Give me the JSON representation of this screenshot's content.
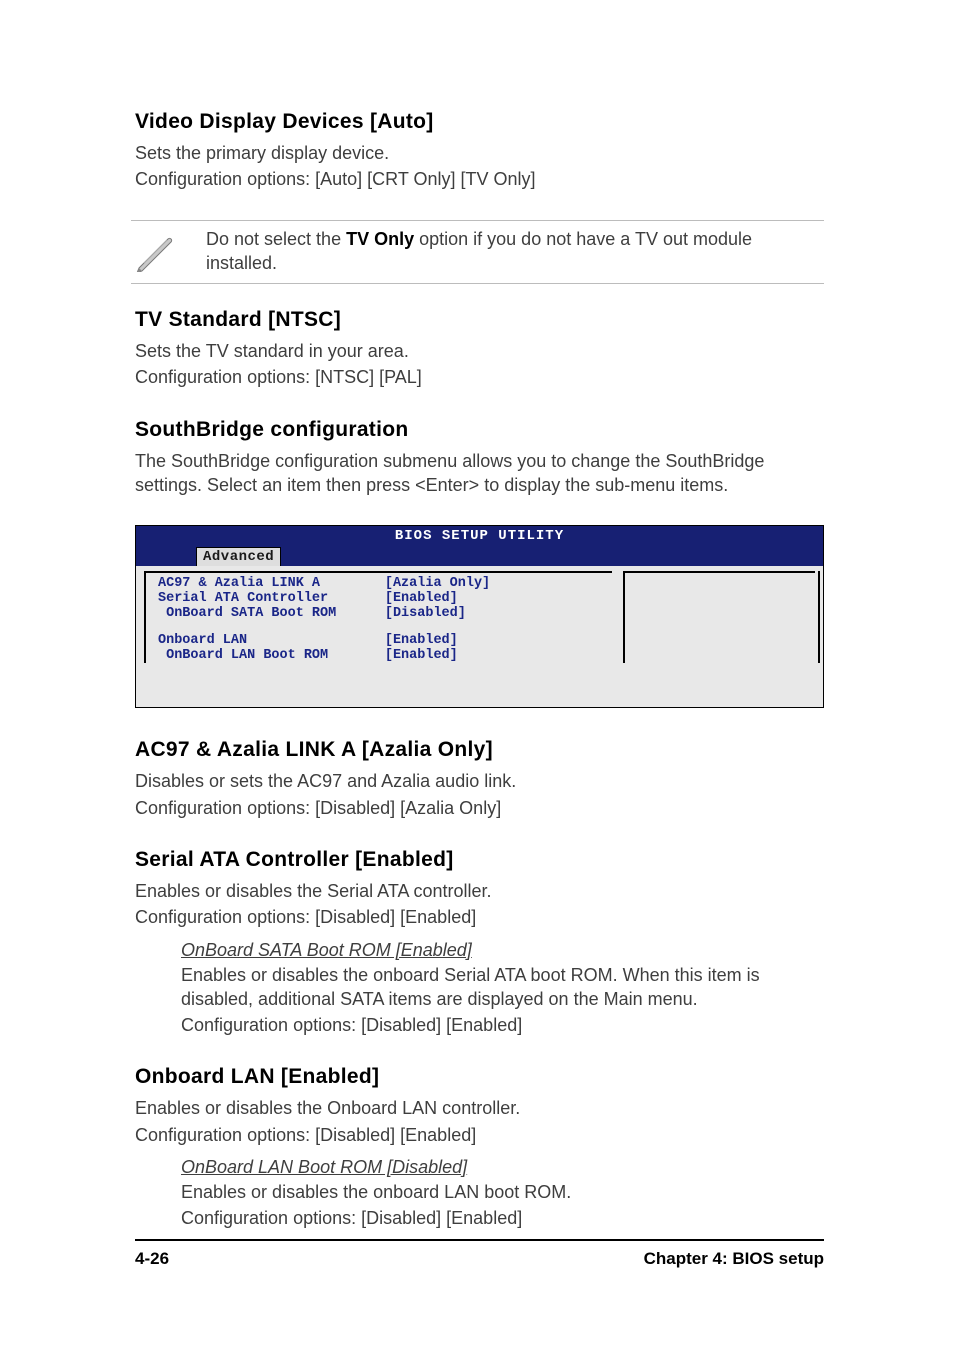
{
  "sections": {
    "video": {
      "heading": "Video Display Devices [Auto]",
      "line1": "Sets the primary display device.",
      "line2": "Configuration options: [Auto] [CRT Only] [TV Only]"
    },
    "note": {
      "pre": "Do not select the ",
      "bold": "TV Only",
      "post": " option if you do not have a TV out module installed."
    },
    "tv": {
      "heading": "TV Standard [NTSC]",
      "line1": "Sets the TV standard  in your area.",
      "line2": "Configuration options: [NTSC] [PAL]"
    },
    "southbridge": {
      "heading": "SouthBridge configuration",
      "line1": "The SouthBridge configuration submenu allows you to change the SouthBridge settings. Select an item then press <Enter> to display the sub-menu items."
    },
    "ac97": {
      "heading": "AC97 & Azalia LINK A [Azalia Only]",
      "line1": "Disables or sets the AC97 and Azalia audio link.",
      "line2": "Configuration options: [Disabled] [Azalia Only]"
    },
    "sata": {
      "heading": "Serial ATA Controller [Enabled]",
      "line1": "Enables or disables the Serial ATA controller.",
      "line2": "Configuration options: [Disabled] [Enabled]",
      "sub": {
        "heading": "OnBoard SATA Boot ROM [Enabled]",
        "line1": "Enables or disables the onboard Serial ATA boot ROM. When this item is disabled, additional SATA items are displayed on the Main menu.",
        "line2": "Configuration options: [Disabled] [Enabled]"
      }
    },
    "lan": {
      "heading": "Onboard LAN [Enabled]",
      "line1": "Enables or disables the Onboard LAN controller.",
      "line2": "Configuration options: [Disabled] [Enabled]",
      "sub": {
        "heading": "OnBoard LAN Boot ROM [Disabled]",
        "line1": "Enables or disables the onboard LAN boot ROM.",
        "line2": "Configuration options: [Disabled] [Enabled]"
      }
    }
  },
  "bios": {
    "title": "BIOS SETUP UTILITY",
    "tab": "Advanced",
    "items": [
      {
        "label": "AC97 & Azalia LINK A",
        "value": "[Azalia Only]"
      },
      {
        "label": "Serial ATA Controller",
        "value": "[Enabled]"
      },
      {
        "label": " OnBoard SATA Boot ROM",
        "value": "[Disabled]"
      },
      {
        "label": "",
        "value": ""
      },
      {
        "label": "Onboard LAN",
        "value": "[Enabled]"
      },
      {
        "label": " OnBoard LAN Boot ROM",
        "value": "[Enabled]"
      }
    ]
  },
  "footer": {
    "left": "4-26",
    "right": "Chapter 4: BIOS setup"
  }
}
